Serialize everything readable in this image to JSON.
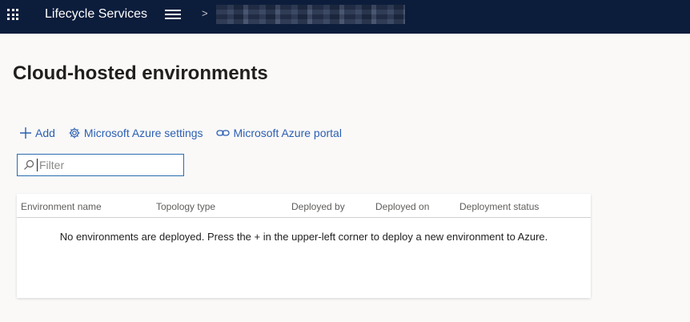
{
  "topbar": {
    "app_title": "Lifecycle Services",
    "breadcrumb_separator": ">"
  },
  "page": {
    "title": "Cloud-hosted environments"
  },
  "commands": {
    "add_label": "Add",
    "azure_settings_label": "Microsoft Azure settings",
    "azure_portal_label": "Microsoft Azure portal"
  },
  "filter": {
    "placeholder": "Filter",
    "value": ""
  },
  "table": {
    "columns": [
      "Environment name",
      "Topology type",
      "Deployed by",
      "Deployed on",
      "Deployment status"
    ],
    "empty_message": "No environments are deployed. Press the + in the upper-left corner to deploy a new environment to Azure."
  },
  "colors": {
    "topbar_bg": "#0c1d3c",
    "accent": "#2b5fb3",
    "page_bg": "#faf9f8"
  }
}
